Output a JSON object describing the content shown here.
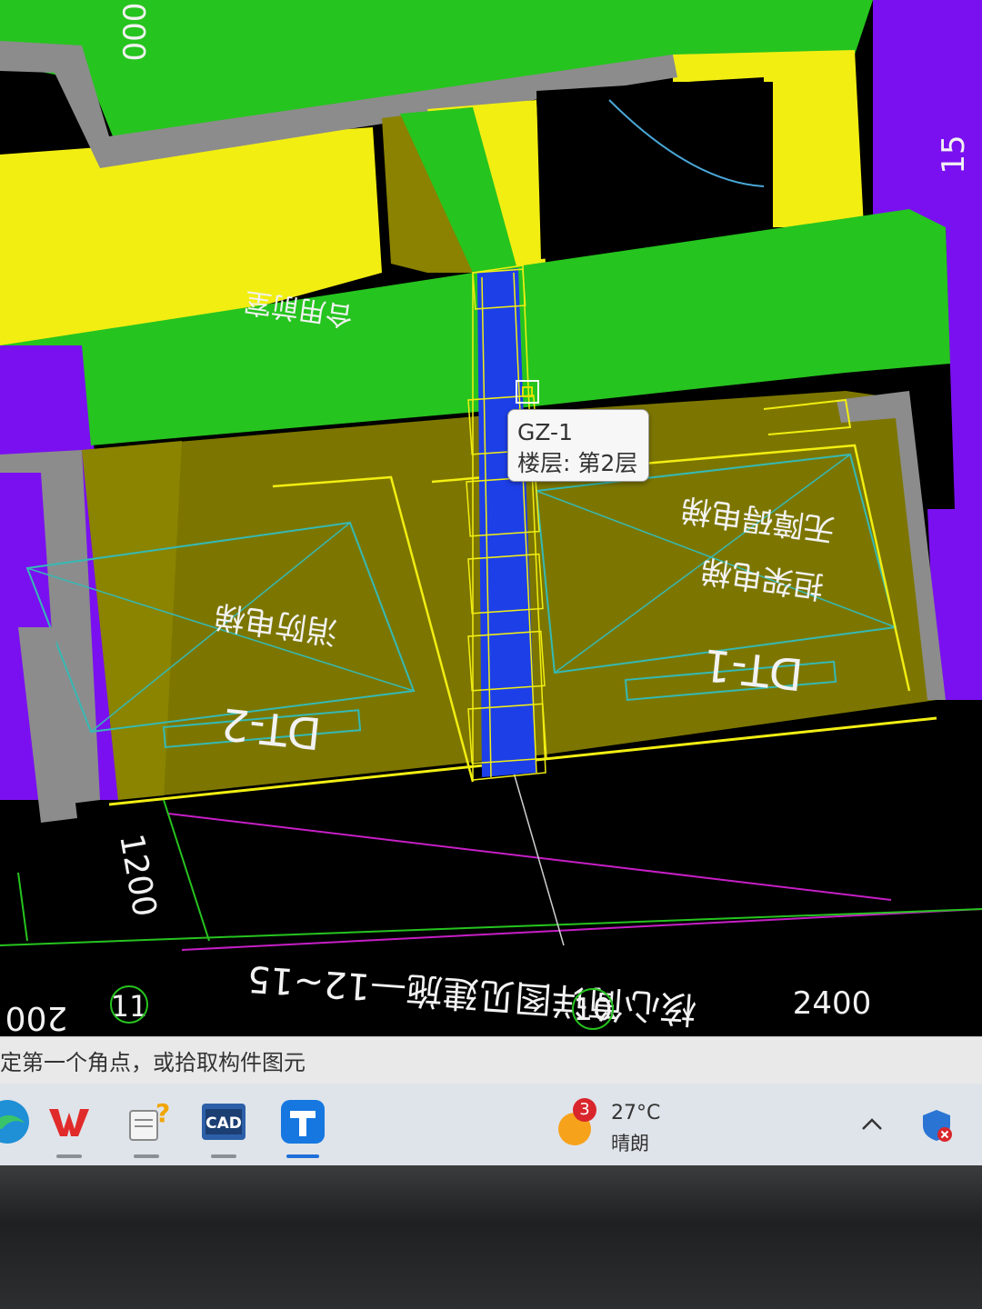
{
  "drawing": {
    "labels": {
      "elevator_left_type": "消防电梯",
      "elevator_left_id": "DT-2",
      "elevator_right_type1": "无障碍电梯",
      "elevator_right_type2": "担架电梯",
      "elevator_right_id": "DT-1",
      "room_upper_left": "合用前室",
      "top_dim": "000",
      "right_edge_mark": "15",
      "dim_vertical": "1200",
      "section_note": "核心筒详图见建施—12~15",
      "axis_11": "11",
      "axis_10": "10",
      "dim_2400": "2400",
      "dim_left": "200"
    }
  },
  "tooltip": {
    "name": "GZ-1",
    "floor": "楼层: 第2层"
  },
  "status_bar": {
    "prompt": "定第一个角点，或拾取构件图元"
  },
  "taskbar": {
    "apps": [
      "edge-icon",
      "wps-icon",
      "notes-icon",
      "cad-icon",
      "glodon-icon"
    ],
    "cad_label": "CAD",
    "weather": {
      "badge": "3",
      "temp": "27°C",
      "condition": "晴朗"
    }
  },
  "colors": {
    "wall_green": "#26c41f",
    "slab_yellow": "#f2ee12",
    "room_olive": "#7c7600",
    "column_blue": "#1d3fe8",
    "boundary_purple": "#7a10f0",
    "accent_blue": "#1e6fd9"
  }
}
